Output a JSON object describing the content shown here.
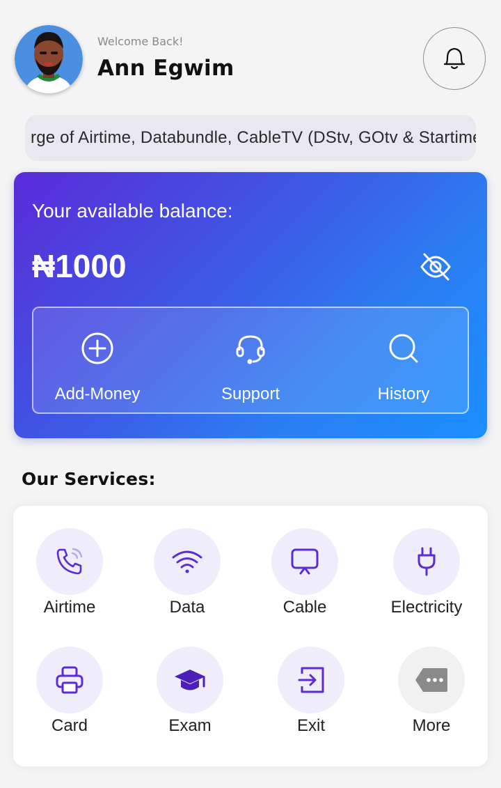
{
  "header": {
    "welcome": "Welcome Back!",
    "user_name": "Ann Egwim",
    "avatar_icon": "user-avatar",
    "notification_icon": "bell-icon"
  },
  "announcement": {
    "text": "rge of Airtime, Databundle, CableTV (DStv, GOtv & Startimes)"
  },
  "balance": {
    "label": "Your available balance:",
    "amount": "₦1000",
    "visibility_icon": "eye-off-icon",
    "actions": [
      {
        "label": "Add-Money",
        "icon": "plus-circle-icon"
      },
      {
        "label": "Support",
        "icon": "headset-icon"
      },
      {
        "label": "History",
        "icon": "search-icon"
      }
    ]
  },
  "services": {
    "title": "Our Services:",
    "items": [
      {
        "label": "Airtime",
        "icon": "phone-icon"
      },
      {
        "label": "Data",
        "icon": "wifi-icon"
      },
      {
        "label": "Cable",
        "icon": "tv-icon"
      },
      {
        "label": "Electricity",
        "icon": "plug-icon"
      },
      {
        "label": "Card",
        "icon": "printer-icon"
      },
      {
        "label": "Exam",
        "icon": "graduation-cap-icon"
      },
      {
        "label": "Exit",
        "icon": "exit-icon"
      },
      {
        "label": "More",
        "icon": "more-tag-icon"
      }
    ]
  },
  "colors": {
    "accent": "#5b2bd6",
    "card_gradient_start": "#5a2bd8",
    "card_gradient_end": "#1b8fff",
    "service_circle": "#efedfb"
  }
}
